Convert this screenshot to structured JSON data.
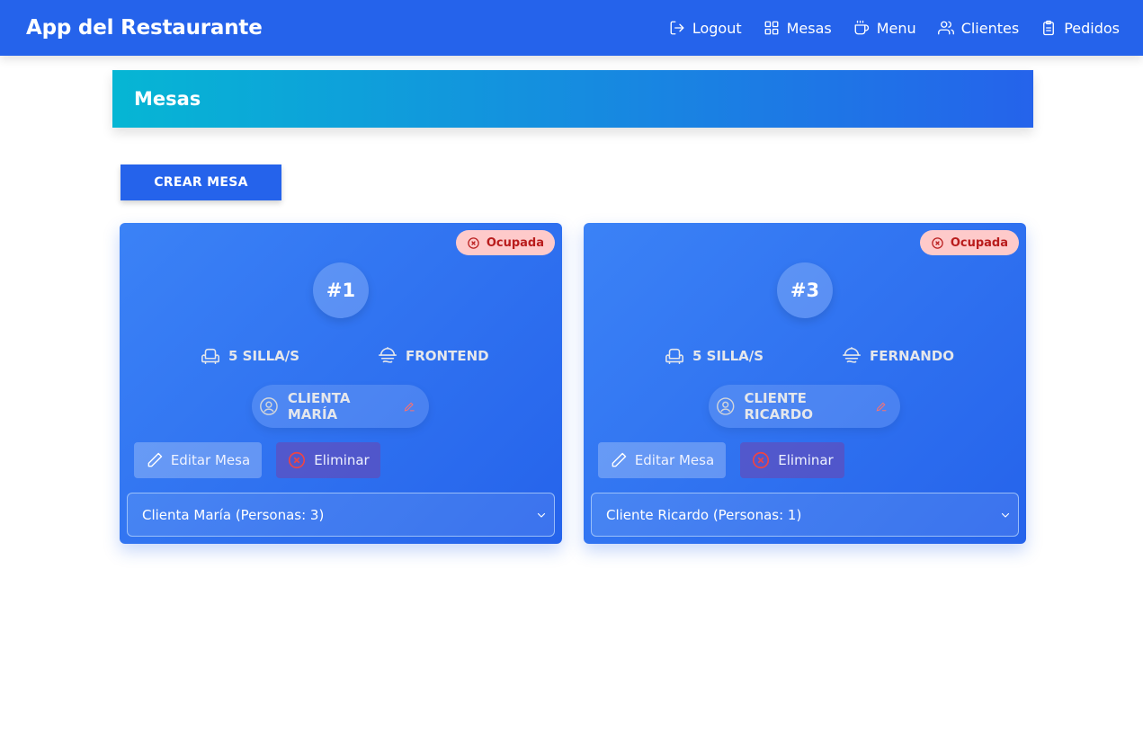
{
  "app": {
    "title": "App del Restaurante"
  },
  "nav": {
    "items": [
      {
        "label": "Logout",
        "icon": "logout-icon"
      },
      {
        "label": "Mesas",
        "icon": "grid-icon"
      },
      {
        "label": "Menu",
        "icon": "coffee-icon"
      },
      {
        "label": "Clientes",
        "icon": "users-icon"
      },
      {
        "label": "Pedidos",
        "icon": "clipboard-icon"
      }
    ]
  },
  "page": {
    "title": "Mesas",
    "create_label": "CREAR MESA"
  },
  "tables": [
    {
      "status": "Ocupada",
      "number": "#1",
      "seats": "5 SILLA/S",
      "waiter": "FRONTEND",
      "client": "CLIENTA MARÍA",
      "edit_label": "Editar Mesa",
      "delete_label": "Eliminar",
      "select_value": "Clienta María (Personas: 3)"
    },
    {
      "status": "Ocupada",
      "number": "#3",
      "seats": "5 SILLA/S",
      "waiter": "FERNANDO",
      "client": "CLIENTE RICARDO",
      "edit_label": "Editar Mesa",
      "delete_label": "Eliminar",
      "select_value": "Cliente Ricardo (Personas: 1)"
    }
  ],
  "colors": {
    "primary": "#2563eb",
    "header_gradient_start": "#06b6d4",
    "status_bg": "#fecaca",
    "status_text": "#b91c1c"
  }
}
